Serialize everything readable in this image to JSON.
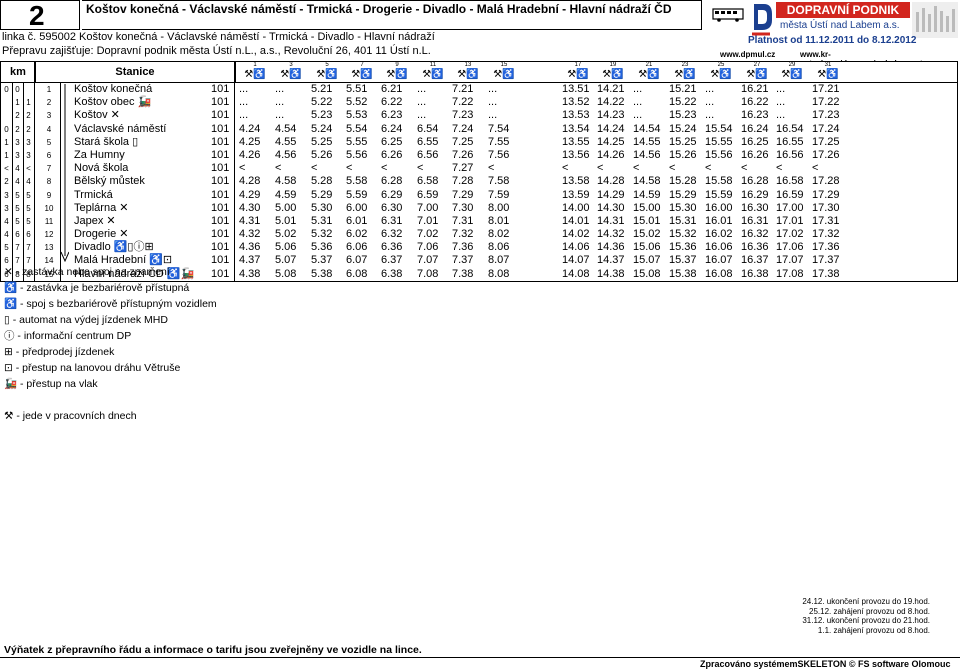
{
  "header": {
    "line_number": "2",
    "title": "Koštov konečná - Václavské náměstí - Trmická - Drogerie - Divadlo - Malá Hradební - Hlavní nádraží ČD",
    "line_label": "linka č. 595002 Koštov konečná - Václavské náměstí - Trmická - Divadlo - Hlavní nádraží",
    "carrier": "Přepravu zajišťuje: Dopravní podnik města Ústí n.L., a.s., Revoluční 26, 401 11 Ústí n.L.",
    "validity": "Platnost od 11.12.2011 do 8.12.2012",
    "web1": "www.dpmul.cz",
    "web2": "www.kr-ustecky.cz/dopravni_obsluznost.asp",
    "logo_text": "DOPRAVNÍ PODNIK",
    "logo_sub1": "města Ústí nad Labem a.s.",
    "logo_sub2": ""
  },
  "table": {
    "km_header": "km",
    "stop_header": "Stanice",
    "trip_numbers": [
      "1",
      "3",
      "5",
      "7",
      "9",
      "11",
      "13",
      "15",
      "17",
      "19",
      "21",
      "23",
      "25",
      "27",
      "29",
      "31"
    ],
    "trip_weekday_mark": "⚒♿",
    "rows": [
      {
        "km": [
          "0",
          "0",
          ""
        ],
        "no": "1",
        "name": "Koštov konečná",
        "zone": "101",
        "times": [
          "...",
          "...",
          "5.21",
          "5.51",
          "6.21",
          "...",
          "7.21",
          "...",
          "13.51",
          "14.21",
          "...",
          "15.21",
          "...",
          "16.21",
          "...",
          "17.21"
        ]
      },
      {
        "km": [
          "",
          "1",
          "1"
        ],
        "no": "2",
        "name": "Koštov obec 🚂",
        "zone": "101",
        "times": [
          "...",
          "...",
          "5.22",
          "5.52",
          "6.22",
          "...",
          "7.22",
          "...",
          "13.52",
          "14.22",
          "...",
          "15.22",
          "...",
          "16.22",
          "...",
          "17.22"
        ]
      },
      {
        "km": [
          "",
          "2",
          "2"
        ],
        "no": "3",
        "name": "Koštov ✕",
        "zone": "101",
        "times": [
          "...",
          "...",
          "5.23",
          "5.53",
          "6.23",
          "...",
          "7.23",
          "...",
          "13.53",
          "14.23",
          "...",
          "15.23",
          "...",
          "16.23",
          "...",
          "17.23"
        ]
      },
      {
        "km": [
          "0",
          "2",
          "2"
        ],
        "no": "4",
        "name": "Václavské náměstí",
        "zone": "101",
        "times": [
          "4.24",
          "4.54",
          "5.24",
          "5.54",
          "6.24",
          "6.54",
          "7.24",
          "7.54",
          "13.54",
          "14.24",
          "14.54",
          "15.24",
          "15.54",
          "16.24",
          "16.54",
          "17.24"
        ]
      },
      {
        "km": [
          "1",
          "3",
          "3"
        ],
        "no": "5",
        "name": "Stará škola ▯",
        "zone": "101",
        "times": [
          "4.25",
          "4.55",
          "5.25",
          "5.55",
          "6.25",
          "6.55",
          "7.25",
          "7.55",
          "13.55",
          "14.25",
          "14.55",
          "15.25",
          "15.55",
          "16.25",
          "16.55",
          "17.25"
        ]
      },
      {
        "km": [
          "1",
          "3",
          "3"
        ],
        "no": "6",
        "name": "Za Humny",
        "zone": "101",
        "times": [
          "4.26",
          "4.56",
          "5.26",
          "5.56",
          "6.26",
          "6.56",
          "7.26",
          "7.56",
          "13.56",
          "14.26",
          "14.56",
          "15.26",
          "15.56",
          "16.26",
          "16.56",
          "17.26"
        ]
      },
      {
        "km": [
          "<",
          "4",
          "<"
        ],
        "no": "7",
        "name": "Nová škola",
        "zone": "101",
        "times": [
          "<",
          "<",
          "<",
          "<",
          "<",
          "<",
          "7.27",
          "<",
          "<",
          "<",
          "<",
          "<",
          "<",
          "<",
          "<",
          "<"
        ]
      },
      {
        "km": [
          "2",
          "4",
          "4"
        ],
        "no": "8",
        "name": "Bělský můstek",
        "zone": "101",
        "times": [
          "4.28",
          "4.58",
          "5.28",
          "5.58",
          "6.28",
          "6.58",
          "7.28",
          "7.58",
          "13.58",
          "14.28",
          "14.58",
          "15.28",
          "15.58",
          "16.28",
          "16.58",
          "17.28"
        ]
      },
      {
        "km": [
          "3",
          "5",
          "5"
        ],
        "no": "9",
        "name": "Trmická",
        "zone": "101",
        "times": [
          "4.29",
          "4.59",
          "5.29",
          "5.59",
          "6.29",
          "6.59",
          "7.29",
          "7.59",
          "13.59",
          "14.29",
          "14.59",
          "15.29",
          "15.59",
          "16.29",
          "16.59",
          "17.29"
        ]
      },
      {
        "km": [
          "3",
          "5",
          "5"
        ],
        "no": "10",
        "name": "Teplárna ✕",
        "zone": "101",
        "times": [
          "4.30",
          "5.00",
          "5.30",
          "6.00",
          "6.30",
          "7.00",
          "7.30",
          "8.00",
          "14.00",
          "14.30",
          "15.00",
          "15.30",
          "16.00",
          "16.30",
          "17.00",
          "17.30"
        ]
      },
      {
        "km": [
          "4",
          "5",
          "5"
        ],
        "no": "11",
        "name": "Japex ✕",
        "zone": "101",
        "times": [
          "4.31",
          "5.01",
          "5.31",
          "6.01",
          "6.31",
          "7.01",
          "7.31",
          "8.01",
          "14.01",
          "14.31",
          "15.01",
          "15.31",
          "16.01",
          "16.31",
          "17.01",
          "17.31"
        ]
      },
      {
        "km": [
          "4",
          "6",
          "6"
        ],
        "no": "12",
        "name": "Drogerie ✕",
        "zone": "101",
        "times": [
          "4.32",
          "5.02",
          "5.32",
          "6.02",
          "6.32",
          "7.02",
          "7.32",
          "8.02",
          "14.02",
          "14.32",
          "15.02",
          "15.32",
          "16.02",
          "16.32",
          "17.02",
          "17.32"
        ]
      },
      {
        "km": [
          "5",
          "7",
          "7"
        ],
        "no": "13",
        "name": "Divadlo ♿▯ⓘ⊞",
        "zone": "101",
        "times": [
          "4.36",
          "5.06",
          "5.36",
          "6.06",
          "6.36",
          "7.06",
          "7.36",
          "8.06",
          "14.06",
          "14.36",
          "15.06",
          "15.36",
          "16.06",
          "16.36",
          "17.06",
          "17.36"
        ]
      },
      {
        "km": [
          "6",
          "7",
          "7"
        ],
        "no": "14",
        "name": "Malá Hradební ♿⊡",
        "zone": "101",
        "times": [
          "4.37",
          "5.07",
          "5.37",
          "6.07",
          "6.37",
          "7.07",
          "7.37",
          "8.07",
          "14.07",
          "14.37",
          "15.07",
          "15.37",
          "16.07",
          "16.37",
          "17.07",
          "17.37"
        ]
      },
      {
        "km": [
          "6",
          "8",
          "8"
        ],
        "no": "15",
        "name": "Hlavní nádraží ČD ♿🚂",
        "zone": "101",
        "times": [
          "4.38",
          "5.08",
          "5.38",
          "6.08",
          "6.38",
          "7.08",
          "7.38",
          "8.08",
          "14.08",
          "14.38",
          "15.08",
          "15.38",
          "16.08",
          "16.38",
          "17.08",
          "17.38"
        ]
      }
    ]
  },
  "legend": [
    "✕ - zastávka nebo spoj na znamení",
    "♿ - zastávka je bezbariérově přístupná",
    "♿ - spoj s bezbariérově přístupným vozidlem",
    "▯ - automat na výdej jízdenek MHD",
    "ⓘ - informační centrum DP",
    "⊞ - předprodej jízdenek",
    "⊡ - přestup na lanovou dráhu Větruše",
    "🚂 - přestup na vlak",
    "",
    "⚒ - jede v pracovních dnech"
  ],
  "notes": [
    "24.12. ukončení provozu do 19.hod.",
    "25.12. zahájení provozu od 8.hod.",
    "31.12. ukončení provozu do 21.hod.",
    "1.1. zahájení provozu od 8.hod."
  ],
  "footer": "Výňatek z přepravního řádu a informace o tarifu jsou zveřejněny ve vozidle na lince.",
  "software": "Zpracováno systémemSKELETON © FS software Olomouc",
  "colors": {
    "brand_red": "#d2261e",
    "brand_blue": "#1b3f8f"
  }
}
